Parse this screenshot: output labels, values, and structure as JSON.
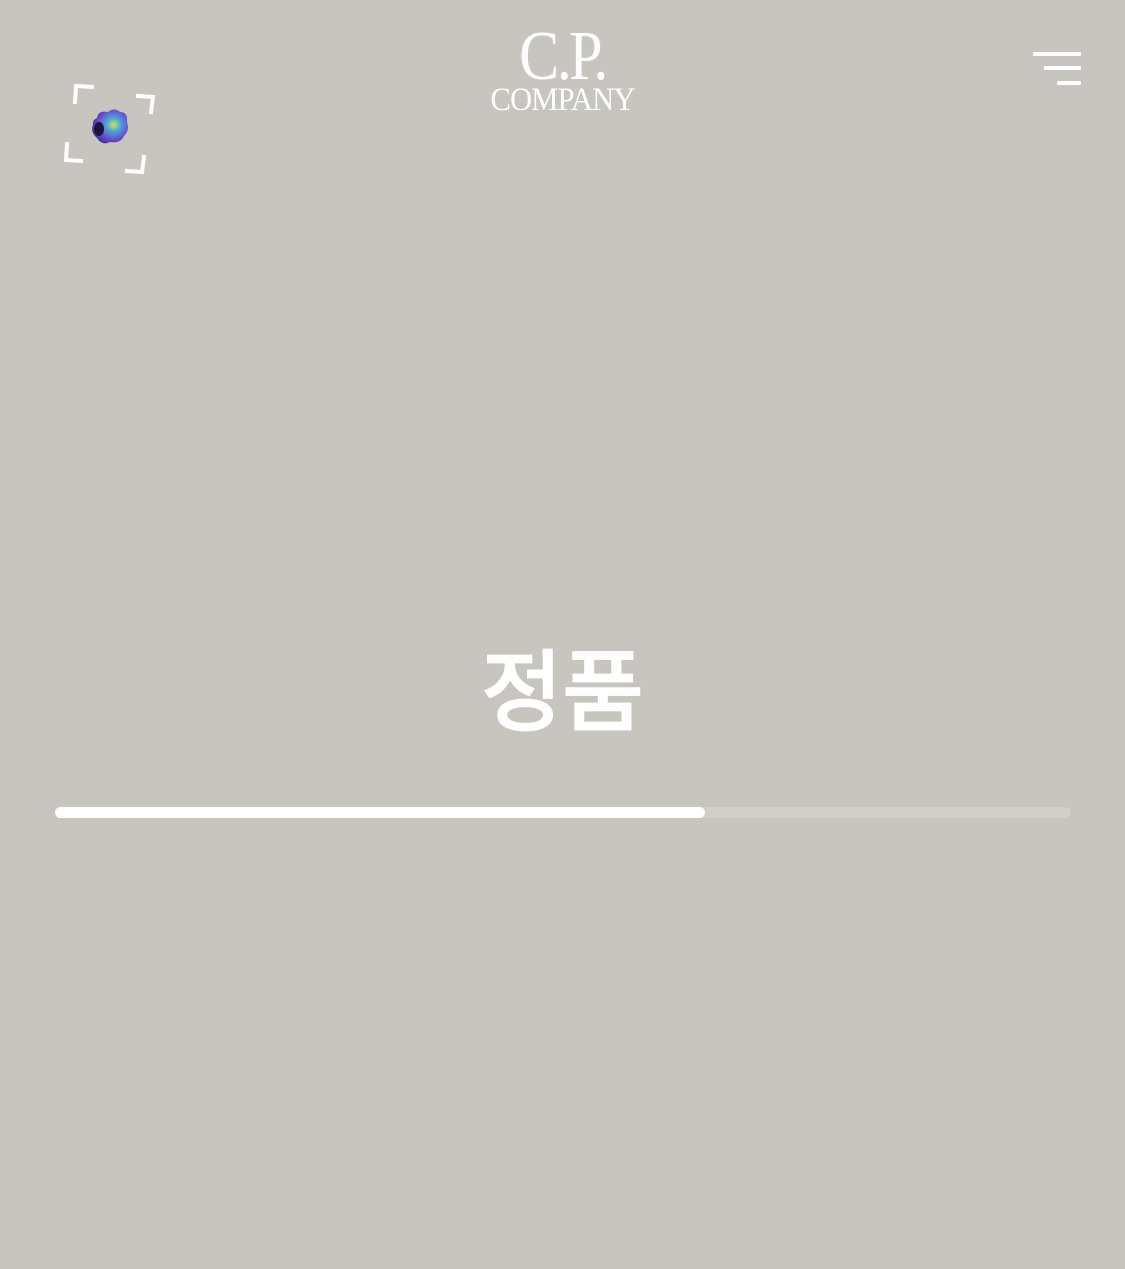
{
  "header": {
    "logo_line1": "C.P.",
    "logo_line2": "COMPANY",
    "scan_icon": "ar-scan-icon",
    "menu_icon": "hamburger-menu-icon"
  },
  "main": {
    "status_text": "정품",
    "progress": 0.64
  },
  "colors": {
    "background": "#c8c5be",
    "foreground": "#ffffff",
    "track": "#d1cec8"
  }
}
